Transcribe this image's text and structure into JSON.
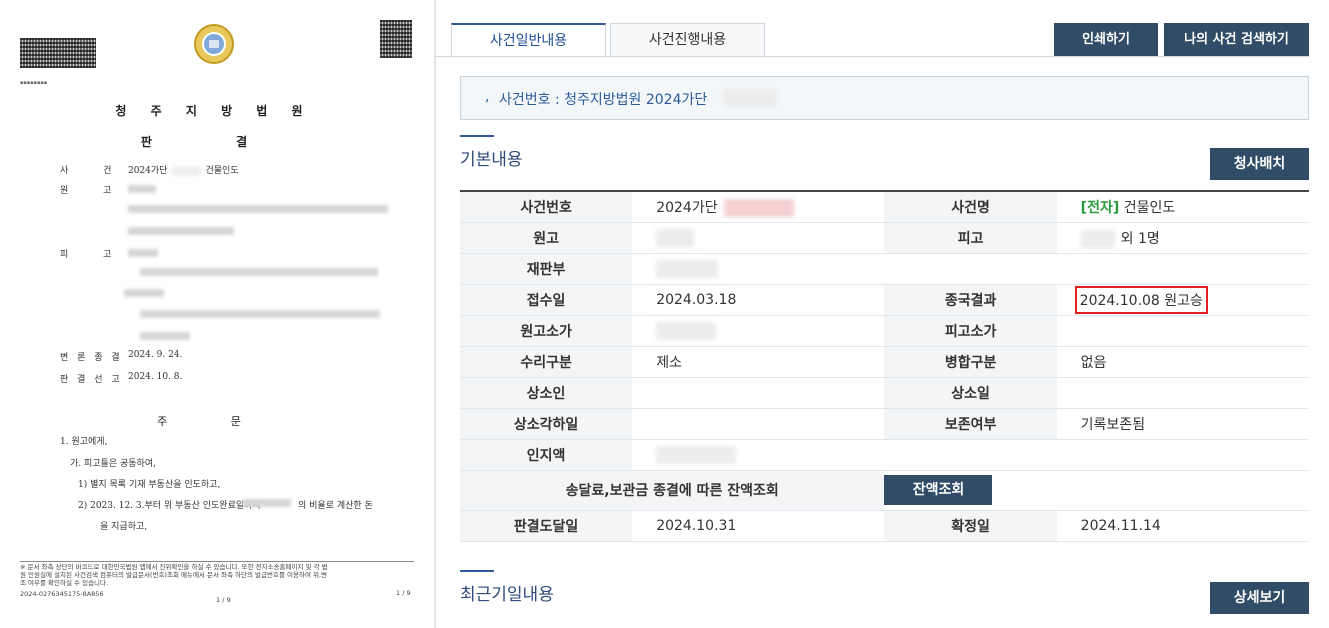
{
  "document": {
    "court": "청 주 지 방 법 원",
    "doc_type": "판 결",
    "case_label": "사 건",
    "case_value": "2024가단",
    "case_name": "건물인도",
    "plaintiff_label": "원 고",
    "defendant_label": "피 고",
    "hearing_end_label": "변 론 종 결",
    "hearing_end_date": "2024. 9. 24.",
    "verdict_label": "판 결 선 고",
    "verdict_date": "2024. 10. 8.",
    "order_title": "주 문",
    "order_lines": [
      "1. 원고에게,",
      "가. 피고들은 공동하여,",
      "1) 별지 목록 기재 부동산을 인도하고,",
      "2) 2023. 12. 3.부터 위 부동산 인도완료일까지",
      "의 비율로 계산한 돈",
      "을 지급하고,"
    ],
    "footer_lines": [
      "※ 문서 좌측 상단의 바코드로 대한민국법원 앱에서 진위확인을 하실 수 있습니다. 또한 전자소송홈페이지 및 각 법",
      "원 민원실에 설치된 사건검색 컴퓨터의 발급문서(번호)조회 메뉴에서 문서 좌측 하단의 발급번호를 이용하여 위,변",
      "조 여부를 확인하실 수 있습니다."
    ],
    "issue_number": "2024-0276345175-8A856",
    "page_number": "1 / 9",
    "page_number_right": "1 / 9"
  },
  "tabs": [
    "사건일반내용",
    "사건진행내용"
  ],
  "buttons": {
    "print": "인쇄하기",
    "my_case_search": "나의 사건 검색하기",
    "court_seating": "청사배치",
    "balance_lookup": "잔액조회",
    "detail_view": "상세보기"
  },
  "case_number_line": "사건번호 : 청주지방법원 2024가단",
  "sections": {
    "basic": "기본내용",
    "recent": "최근기일내용"
  },
  "info": {
    "labels": {
      "case_no": "사건번호",
      "case_name": "사건명",
      "plaintiff": "원고",
      "defendant": "피고",
      "court_panel": "재판부",
      "received": "접수일",
      "final_result": "종국결과",
      "plaintiff_amount": "원고소가",
      "defendant_amount": "피고소가",
      "acceptance_type": "수리구분",
      "merge_type": "병합구분",
      "appellant": "상소인",
      "appeal_date": "상소일",
      "appeal_dismissal": "상소각하일",
      "preservation": "보존여부",
      "stamp_fee": "인지액",
      "deposit_balance": "송달료,보관금 종결에 따른 잔액조회",
      "judgment_delivered": "판결도달일",
      "finalized": "확정일"
    },
    "values": {
      "case_no": "2024가단",
      "case_name_tag": "[전자]",
      "case_name": "건물인도",
      "defendant_suffix": "외 1명",
      "received": "2024.03.18",
      "final_result": "2024.10.08 원고승",
      "acceptance_type": "제소",
      "merge_type": "없음",
      "preservation": "기록보존됨",
      "judgment_delivered": "2024.10.31",
      "finalized": "2024.11.14"
    }
  },
  "colors": {
    "button": "#304c66",
    "accent": "#2f5c99",
    "highlight": "#e02020",
    "tag_green": "#2a9a3a"
  }
}
